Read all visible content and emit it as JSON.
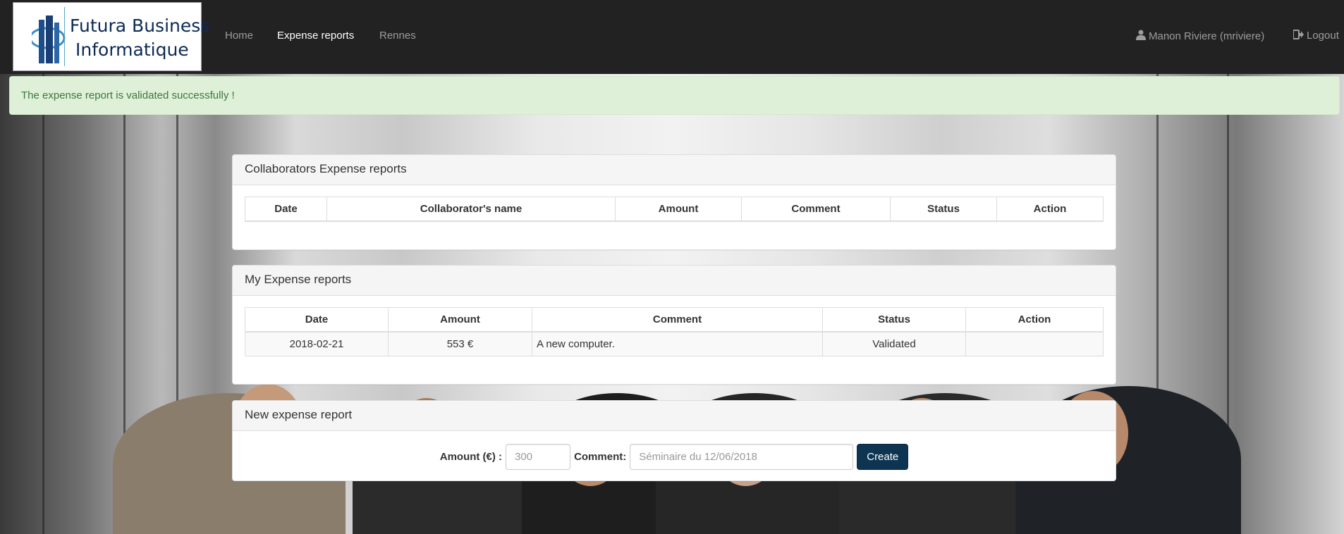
{
  "brand": {
    "line1": "Futura Business",
    "line2": "Informatique"
  },
  "nav": {
    "home": "Home",
    "expense_reports": "Expense reports",
    "rennes": "Rennes",
    "user": "Manon Riviere (mriviere)",
    "logout": "Logout"
  },
  "alert": {
    "message": "The expense report is validated successfully !"
  },
  "collab_panel": {
    "title": "Collaborators Expense reports",
    "columns": [
      "Date",
      "Collaborator's name",
      "Amount",
      "Comment",
      "Status",
      "Action"
    ],
    "rows": []
  },
  "my_panel": {
    "title": "My Expense reports",
    "columns": [
      "Date",
      "Amount",
      "Comment",
      "Status",
      "Action"
    ],
    "rows": [
      {
        "date": "2018-02-21",
        "amount": "553 €",
        "comment": "A new computer.",
        "status": "Validated",
        "action": ""
      }
    ]
  },
  "new_panel": {
    "title": "New expense report",
    "amount_label": "Amount (€) :",
    "amount_placeholder": "300",
    "comment_label": "Comment:",
    "comment_placeholder": "Séminaire du 12/06/2018",
    "create_label": "Create"
  },
  "colors": {
    "navbar": "#222222",
    "alert_bg": "#dff0d8",
    "alert_text": "#3c763d",
    "button": "#0d3552"
  },
  "icons": {
    "user": "user-icon",
    "logout": "logout-icon",
    "logo": "building-logo-icon"
  }
}
